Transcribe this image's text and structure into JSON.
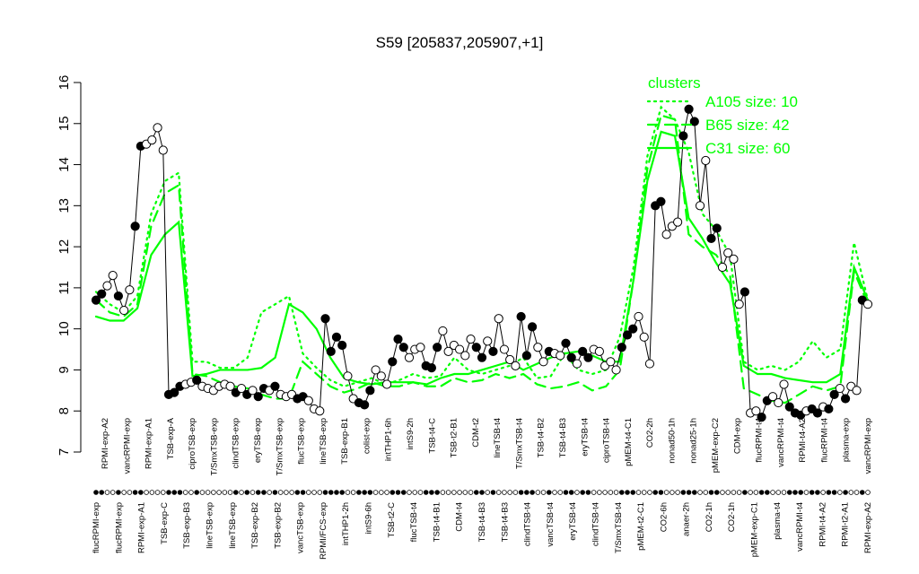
{
  "chart_data": {
    "type": "line",
    "title": "S59 [205837,205907,+1]",
    "xlabel": "",
    "ylabel": "",
    "ylim": [
      7,
      16
    ],
    "yticks": [
      7,
      8,
      9,
      10,
      11,
      12,
      13,
      14,
      15,
      16
    ],
    "legend": {
      "title": "clusters",
      "placement": "top-right",
      "entries": [
        "A105 size: 10",
        "B65 size: 42",
        "C31 size: 60"
      ]
    },
    "colors": {
      "clusters": "#00ff00",
      "points_filled": "#000000",
      "points_open": "#ffffff",
      "axis": "#000000"
    },
    "x_labels_top_row": [
      "RPMI-exp-A2",
      "vancRPMI-exp",
      "RPMI-exp-A1",
      "TSB-exp-A",
      "ciproTSB-exp",
      "T/SmxTSB-exp",
      "clindTSB-exp",
      "eryTSB-exp",
      "T/SmxTSB-exp",
      "flucTSB-exp",
      "lineTSB-exp",
      "TSB-exp-B1",
      "colist-exp",
      "intTHP1-6h",
      "intS9-2h",
      "TSB-t4-C",
      "TSB-t2-B1",
      "CDM-t2",
      "lineTSB-t4",
      "T/SmxTSB-t4",
      "TSB-t4-B2",
      "TSB-t4-B3",
      "eryTSB-t4",
      "ciproTSB-t4",
      "pMEM-t4-C1",
      "CO2-2h",
      "nonad50-1h",
      "nonad25-1h",
      "pMEM-exp-C2",
      "CDM-exp",
      "flucRPMI-t4",
      "vancRPMI-t4",
      "RPMI-t4-A2",
      "flucRPMI-t4",
      "plasma-exp",
      "vancRPMI-exp"
    ],
    "x_labels_bottom_row": [
      "flucRPMI-exp",
      "flucRPMI-exp",
      "RPMI-exp-A1",
      "TSB-exp-C",
      "TSB-exp-B3",
      "lineTSB-exp",
      "lineTSB-exp",
      "TSB-exp-B2",
      "TSB-exp-B2",
      "vancTSB-exp",
      "RPMI/FCS-exp",
      "intTHP1-2h",
      "intS9-6h",
      "TSB-t2-C",
      "flucTSB-t4",
      "TSB-t4-B1",
      "CDM-t4",
      "TSB-t4-B3",
      "TSB-t4-B3",
      "clindTSB-t4",
      "vancTSB-t4",
      "eryTSB-t4",
      "clindTSB-t4",
      "T/SmxTSB-t4",
      "pMEM-t2-C1",
      "CO2-6h",
      "anaer-2h",
      "CO2-1h",
      "CO2-1h",
      "pMEM-exp-C1",
      "plasma-t4",
      "vancRPMI-t4",
      "RPMI-t4-A2",
      "RPMI-t2-A1",
      "RPMI-exp-A2"
    ],
    "samples": [
      {
        "y": 10.7,
        "filled": true
      },
      {
        "y": 10.85,
        "filled": true
      },
      {
        "y": 11.05,
        "filled": false
      },
      {
        "y": 11.3,
        "filled": false
      },
      {
        "y": 10.8,
        "filled": true
      },
      {
        "y": 10.45,
        "filled": false
      },
      {
        "y": 10.95,
        "filled": false
      },
      {
        "y": 12.5,
        "filled": true
      },
      {
        "y": 14.45,
        "filled": true
      },
      {
        "y": 14.5,
        "filled": false
      },
      {
        "y": 14.6,
        "filled": false
      },
      {
        "y": 14.9,
        "filled": false
      },
      {
        "y": 14.35,
        "filled": false
      },
      {
        "y": 8.4,
        "filled": true
      },
      {
        "y": 8.45,
        "filled": true
      },
      {
        "y": 8.6,
        "filled": true
      },
      {
        "y": 8.65,
        "filled": false
      },
      {
        "y": 8.7,
        "filled": false
      },
      {
        "y": 8.75,
        "filled": true
      },
      {
        "y": 8.6,
        "filled": false
      },
      {
        "y": 8.55,
        "filled": false
      },
      {
        "y": 8.5,
        "filled": false
      },
      {
        "y": 8.6,
        "filled": false
      },
      {
        "y": 8.65,
        "filled": false
      },
      {
        "y": 8.6,
        "filled": false
      },
      {
        "y": 8.45,
        "filled": true
      },
      {
        "y": 8.55,
        "filled": false
      },
      {
        "y": 8.4,
        "filled": true
      },
      {
        "y": 8.5,
        "filled": false
      },
      {
        "y": 8.35,
        "filled": true
      },
      {
        "y": 8.55,
        "filled": true
      },
      {
        "y": 8.5,
        "filled": false
      },
      {
        "y": 8.6,
        "filled": true
      },
      {
        "y": 8.4,
        "filled": false
      },
      {
        "y": 8.35,
        "filled": false
      },
      {
        "y": 8.4,
        "filled": false
      },
      {
        "y": 8.3,
        "filled": true
      },
      {
        "y": 8.35,
        "filled": true
      },
      {
        "y": 8.25,
        "filled": false
      },
      {
        "y": 8.05,
        "filled": false
      },
      {
        "y": 8.0,
        "filled": false
      },
      {
        "y": 10.25,
        "filled": true
      },
      {
        "y": 9.45,
        "filled": true
      },
      {
        "y": 9.8,
        "filled": true
      },
      {
        "y": 9.6,
        "filled": true
      },
      {
        "y": 8.85,
        "filled": false
      },
      {
        "y": 8.3,
        "filled": false
      },
      {
        "y": 8.2,
        "filled": true
      },
      {
        "y": 8.15,
        "filled": true
      },
      {
        "y": 8.5,
        "filled": true
      },
      {
        "y": 9.0,
        "filled": false
      },
      {
        "y": 8.85,
        "filled": false
      },
      {
        "y": 8.65,
        "filled": false
      },
      {
        "y": 9.2,
        "filled": true
      },
      {
        "y": 9.75,
        "filled": true
      },
      {
        "y": 9.55,
        "filled": true
      },
      {
        "y": 9.3,
        "filled": false
      },
      {
        "y": 9.5,
        "filled": false
      },
      {
        "y": 9.55,
        "filled": false
      },
      {
        "y": 9.1,
        "filled": true
      },
      {
        "y": 9.05,
        "filled": true
      },
      {
        "y": 9.55,
        "filled": true
      },
      {
        "y": 9.95,
        "filled": false
      },
      {
        "y": 9.45,
        "filled": false
      },
      {
        "y": 9.6,
        "filled": false
      },
      {
        "y": 9.5,
        "filled": false
      },
      {
        "y": 9.35,
        "filled": false
      },
      {
        "y": 9.75,
        "filled": false
      },
      {
        "y": 9.55,
        "filled": true
      },
      {
        "y": 9.3,
        "filled": true
      },
      {
        "y": 9.7,
        "filled": false
      },
      {
        "y": 9.45,
        "filled": true
      },
      {
        "y": 10.25,
        "filled": false
      },
      {
        "y": 9.5,
        "filled": false
      },
      {
        "y": 9.25,
        "filled": false
      },
      {
        "y": 9.1,
        "filled": false
      },
      {
        "y": 10.3,
        "filled": true
      },
      {
        "y": 9.35,
        "filled": true
      },
      {
        "y": 10.05,
        "filled": true
      },
      {
        "y": 9.55,
        "filled": false
      },
      {
        "y": 9.2,
        "filled": false
      },
      {
        "y": 9.45,
        "filled": true
      },
      {
        "y": 9.4,
        "filled": false
      },
      {
        "y": 9.35,
        "filled": false
      },
      {
        "y": 9.65,
        "filled": true
      },
      {
        "y": 9.3,
        "filled": true
      },
      {
        "y": 9.15,
        "filled": false
      },
      {
        "y": 9.45,
        "filled": true
      },
      {
        "y": 9.3,
        "filled": true
      },
      {
        "y": 9.5,
        "filled": false
      },
      {
        "y": 9.45,
        "filled": false
      },
      {
        "y": 9.1,
        "filled": false
      },
      {
        "y": 9.2,
        "filled": false
      },
      {
        "y": 9.0,
        "filled": false
      },
      {
        "y": 9.55,
        "filled": true
      },
      {
        "y": 9.85,
        "filled": true
      },
      {
        "y": 10.0,
        "filled": true
      },
      {
        "y": 10.3,
        "filled": false
      },
      {
        "y": 9.8,
        "filled": false
      },
      {
        "y": 9.15,
        "filled": false
      },
      {
        "y": 13.0,
        "filled": true
      },
      {
        "y": 13.1,
        "filled": true
      },
      {
        "y": 12.3,
        "filled": false
      },
      {
        "y": 12.5,
        "filled": false
      },
      {
        "y": 12.6,
        "filled": false
      },
      {
        "y": 14.7,
        "filled": true
      },
      {
        "y": 15.35,
        "filled": true
      },
      {
        "y": 15.05,
        "filled": true
      },
      {
        "y": 13.0,
        "filled": false
      },
      {
        "y": 14.1,
        "filled": false
      },
      {
        "y": 12.2,
        "filled": true
      },
      {
        "y": 12.45,
        "filled": true
      },
      {
        "y": 11.5,
        "filled": false
      },
      {
        "y": 11.85,
        "filled": false
      },
      {
        "y": 11.7,
        "filled": false
      },
      {
        "y": 10.6,
        "filled": false
      },
      {
        "y": 10.9,
        "filled": true
      },
      {
        "y": 7.95,
        "filled": false
      },
      {
        "y": 8.0,
        "filled": false
      },
      {
        "y": 7.85,
        "filled": true
      },
      {
        "y": 8.25,
        "filled": true
      },
      {
        "y": 8.35,
        "filled": false
      },
      {
        "y": 8.2,
        "filled": false
      },
      {
        "y": 8.65,
        "filled": false
      },
      {
        "y": 8.1,
        "filled": true
      },
      {
        "y": 7.95,
        "filled": true
      },
      {
        "y": 7.9,
        "filled": true
      },
      {
        "y": 8.0,
        "filled": false
      },
      {
        "y": 8.05,
        "filled": true
      },
      {
        "y": 7.95,
        "filled": true
      },
      {
        "y": 8.1,
        "filled": false
      },
      {
        "y": 8.05,
        "filled": true
      },
      {
        "y": 8.4,
        "filled": true
      },
      {
        "y": 8.55,
        "filled": false
      },
      {
        "y": 8.3,
        "filled": true
      },
      {
        "y": 8.6,
        "filled": false
      },
      {
        "y": 8.5,
        "filled": false
      },
      {
        "y": 10.7,
        "filled": true
      },
      {
        "y": 10.6,
        "filled": false
      }
    ],
    "series": [
      {
        "name": "A105 size: 10",
        "style": "dotted",
        "values": [
          10.9,
          10.6,
          10.4,
          10.8,
          12.8,
          13.6,
          13.8,
          9.2,
          9.2,
          9.05,
          9.05,
          9.3,
          10.4,
          10.6,
          10.8,
          9.4,
          9.05,
          8.75,
          8.6,
          8.7,
          8.8,
          8.65,
          8.75,
          8.9,
          8.8,
          8.85,
          9.3,
          9.0,
          8.9,
          9.0,
          9.1,
          9.3,
          8.8,
          8.85,
          9.4,
          9.0,
          8.9,
          9.0,
          9.8,
          11.5,
          14.2,
          15.4,
          15.1,
          14.3,
          12.8,
          12.4,
          11.8,
          9.2,
          9.0,
          9.1,
          9.0,
          9.2,
          9.7,
          9.3,
          9.5,
          12.1,
          10.7
        ]
      },
      {
        "name": "B65 size: 42",
        "style": "dashed",
        "values": [
          10.7,
          10.4,
          10.3,
          10.6,
          12.5,
          13.3,
          13.5,
          8.9,
          8.85,
          8.7,
          8.6,
          8.55,
          8.4,
          8.3,
          8.3,
          9.2,
          8.9,
          8.6,
          8.45,
          8.55,
          8.7,
          8.6,
          8.6,
          8.7,
          8.6,
          8.6,
          8.8,
          8.7,
          8.75,
          8.9,
          8.8,
          8.9,
          8.65,
          8.55,
          8.6,
          8.7,
          8.5,
          8.6,
          9.0,
          11.2,
          13.9,
          15.2,
          15.1,
          12.3,
          12.0,
          11.8,
          11.3,
          8.55,
          8.4,
          8.25,
          8.2,
          8.4,
          8.6,
          8.5,
          8.6,
          11.4,
          10.6
        ]
      },
      {
        "name": "C31 size: 60",
        "style": "solid",
        "values": [
          10.3,
          10.2,
          10.2,
          10.5,
          11.8,
          12.3,
          12.6,
          8.85,
          8.9,
          9.0,
          9.0,
          9.0,
          9.05,
          9.3,
          10.6,
          10.4,
          10.0,
          9.3,
          8.8,
          8.7,
          8.65,
          8.7,
          8.7,
          8.7,
          8.65,
          8.8,
          8.9,
          8.9,
          9.0,
          9.1,
          9.2,
          9.0,
          9.15,
          9.3,
          9.4,
          9.45,
          9.35,
          9.2,
          9.2,
          11.2,
          13.6,
          14.8,
          14.7,
          12.7,
          12.2,
          11.6,
          11.1,
          9.1,
          8.9,
          8.9,
          8.8,
          8.75,
          8.7,
          8.7,
          8.9,
          11.5,
          10.7
        ]
      }
    ]
  }
}
